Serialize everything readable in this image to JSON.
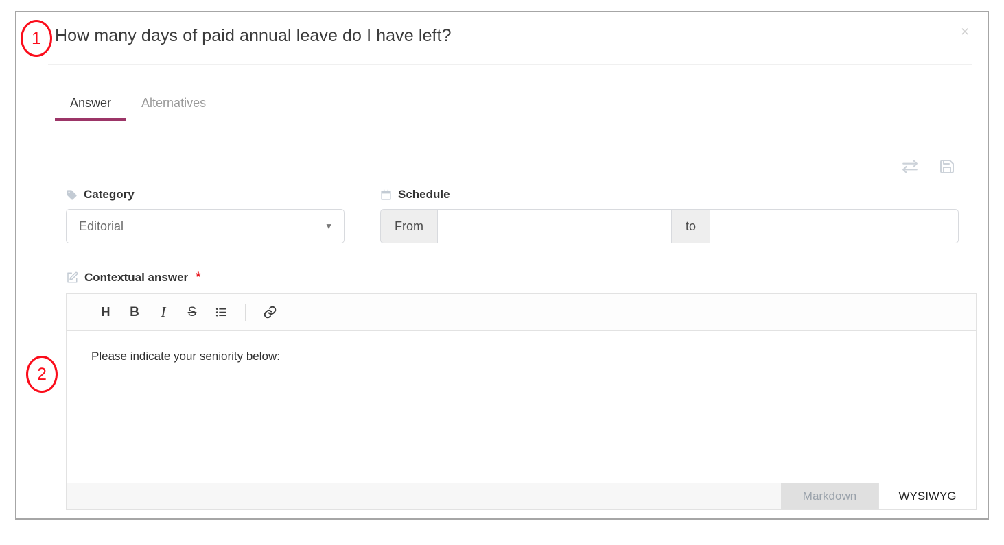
{
  "annotations": [
    {
      "number": "1"
    },
    {
      "number": "2"
    }
  ],
  "dialog": {
    "title": "How many days of paid annual leave do I have left?",
    "close_label": "×",
    "close_icon": "close-icon"
  },
  "tabs": [
    {
      "label": "Answer",
      "active": true
    },
    {
      "label": "Alternatives",
      "active": false
    }
  ],
  "actions": [
    {
      "icon": "exchange-arrows-icon",
      "label": "Switch"
    },
    {
      "icon": "floppy-save-icon",
      "label": "Save"
    }
  ],
  "category": {
    "icon": "tag-icon",
    "label": "Category",
    "selected": "Editorial",
    "caret": "▼",
    "options": [
      "Editorial"
    ]
  },
  "schedule": {
    "icon": "calendar-icon",
    "label": "Schedule",
    "from_addon": "From",
    "from_value": "",
    "from_placeholder": "",
    "to_addon": "to",
    "to_value": "",
    "to_placeholder": ""
  },
  "contextual_answer": {
    "icon": "edit-square-icon",
    "label": "Contextual answer",
    "required_marker": "*",
    "toolbar": [
      {
        "icon": "heading-icon",
        "label": "H"
      },
      {
        "icon": "bold-icon",
        "label": "B"
      },
      {
        "icon": "italic-icon",
        "label": "I"
      },
      {
        "icon": "strikethrough-icon",
        "label": "S"
      },
      {
        "icon": "bullet-list-icon",
        "label": ""
      },
      {
        "icon": "link-icon",
        "label": ""
      }
    ],
    "content": "Please indicate your seniority below:",
    "modes": [
      {
        "label": "Markdown",
        "active": false
      },
      {
        "label": "WYSIWYG",
        "active": true
      }
    ]
  },
  "colors": {
    "accent": "#9c3567",
    "required": "#e8161d",
    "annotation": "#fb0d1b",
    "muted_icon": "#ccd2d9",
    "card_border": "#a6a6a6"
  }
}
